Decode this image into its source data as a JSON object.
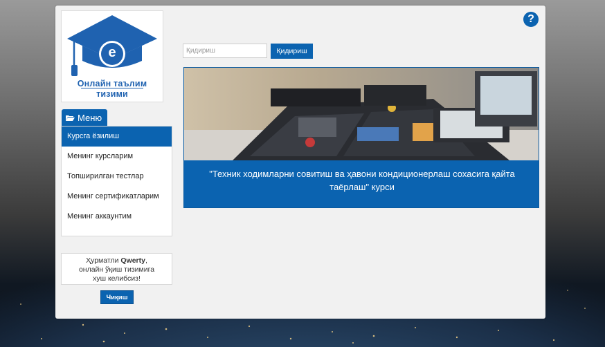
{
  "logo": {
    "line1": "Онлайн таълим",
    "line2": "тизими",
    "badge_letter": "e",
    "icon": "graduation-cap-icon"
  },
  "help": {
    "label": "?"
  },
  "menu": {
    "tab_label": "Меню",
    "tab_icon": "folder-open-icon",
    "items": [
      {
        "label": "Курсга ёзилиш",
        "active": true
      },
      {
        "label": "Менинг курсларим",
        "active": false
      },
      {
        "label": "Топширилган тестлар",
        "active": false
      },
      {
        "label": "Менинг сертификатларим",
        "active": false
      },
      {
        "label": "Менинг аккаунтим",
        "active": false
      }
    ]
  },
  "search": {
    "placeholder": "Қидириш",
    "value": "",
    "button_label": "Қидириш"
  },
  "course": {
    "title": "\"Техник ходимларни совитиш ва ҳавони кондиционерлаш сохасига қайта таёрлаш\" курси",
    "image": "hvac-tool-case-photo"
  },
  "welcome": {
    "greeting_prefix": "Ҳурматли",
    "username": "Qwerty",
    "line2": "онлайн ўқиш тизимига",
    "line3": "хуш келибсиз!"
  },
  "logout": {
    "label": "Чиқиш"
  },
  "colors": {
    "accent": "#0b63b0",
    "panel": "#f1f1f1"
  }
}
